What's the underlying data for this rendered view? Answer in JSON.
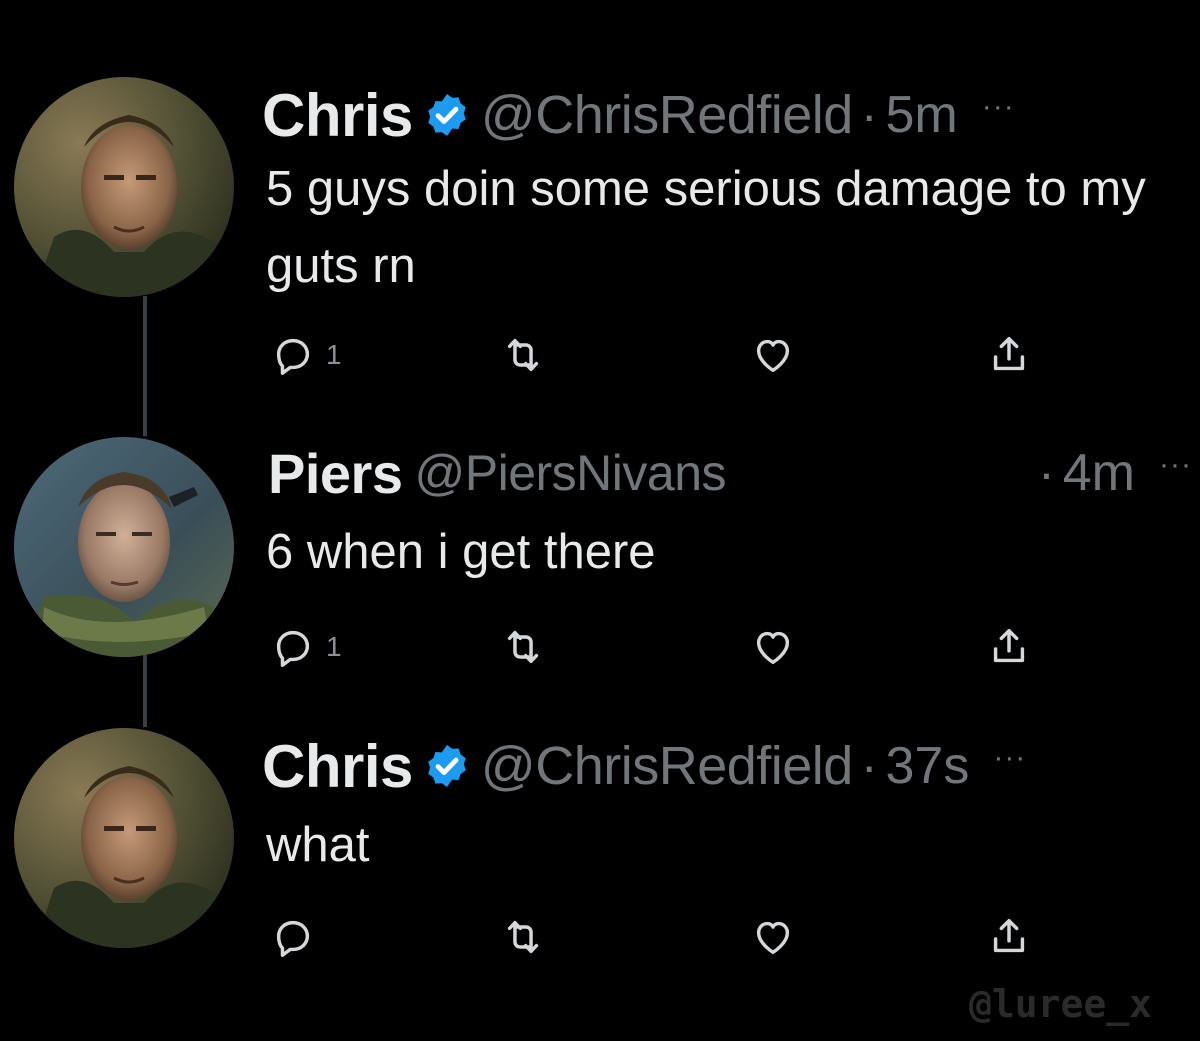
{
  "tweets": [
    {
      "display_name": "Chris",
      "verified": true,
      "handle": "@ChrisRedfield",
      "separator": "·",
      "time": "5m",
      "more": "···",
      "text": "5 guys doin some serious damage to my guts rn",
      "reply_count": "1",
      "avatar": "chris-redfield-avatar"
    },
    {
      "display_name": "Piers",
      "verified": false,
      "handle": "@PiersNivans",
      "separator": "·",
      "time": "4m",
      "more": "···",
      "text": "6 when i get there",
      "reply_count": "1",
      "avatar": "piers-nivans-avatar"
    },
    {
      "display_name": "Chris",
      "verified": true,
      "handle": "@ChrisRedfield",
      "separator": "·",
      "time": "37s",
      "more": "···",
      "text": "what",
      "reply_count": "",
      "avatar": "chris-redfield-avatar"
    }
  ],
  "icons": {
    "reply": "reply-icon",
    "retweet": "retweet-icon",
    "like": "heart-icon",
    "share": "share-icon",
    "verified": "verified-badge-icon",
    "more": "more-icon"
  },
  "colors": {
    "background": "#000000",
    "text": "#e7e9ea",
    "muted": "#71767b",
    "verified": "#1d9bf0"
  },
  "watermark": "@luree_x"
}
